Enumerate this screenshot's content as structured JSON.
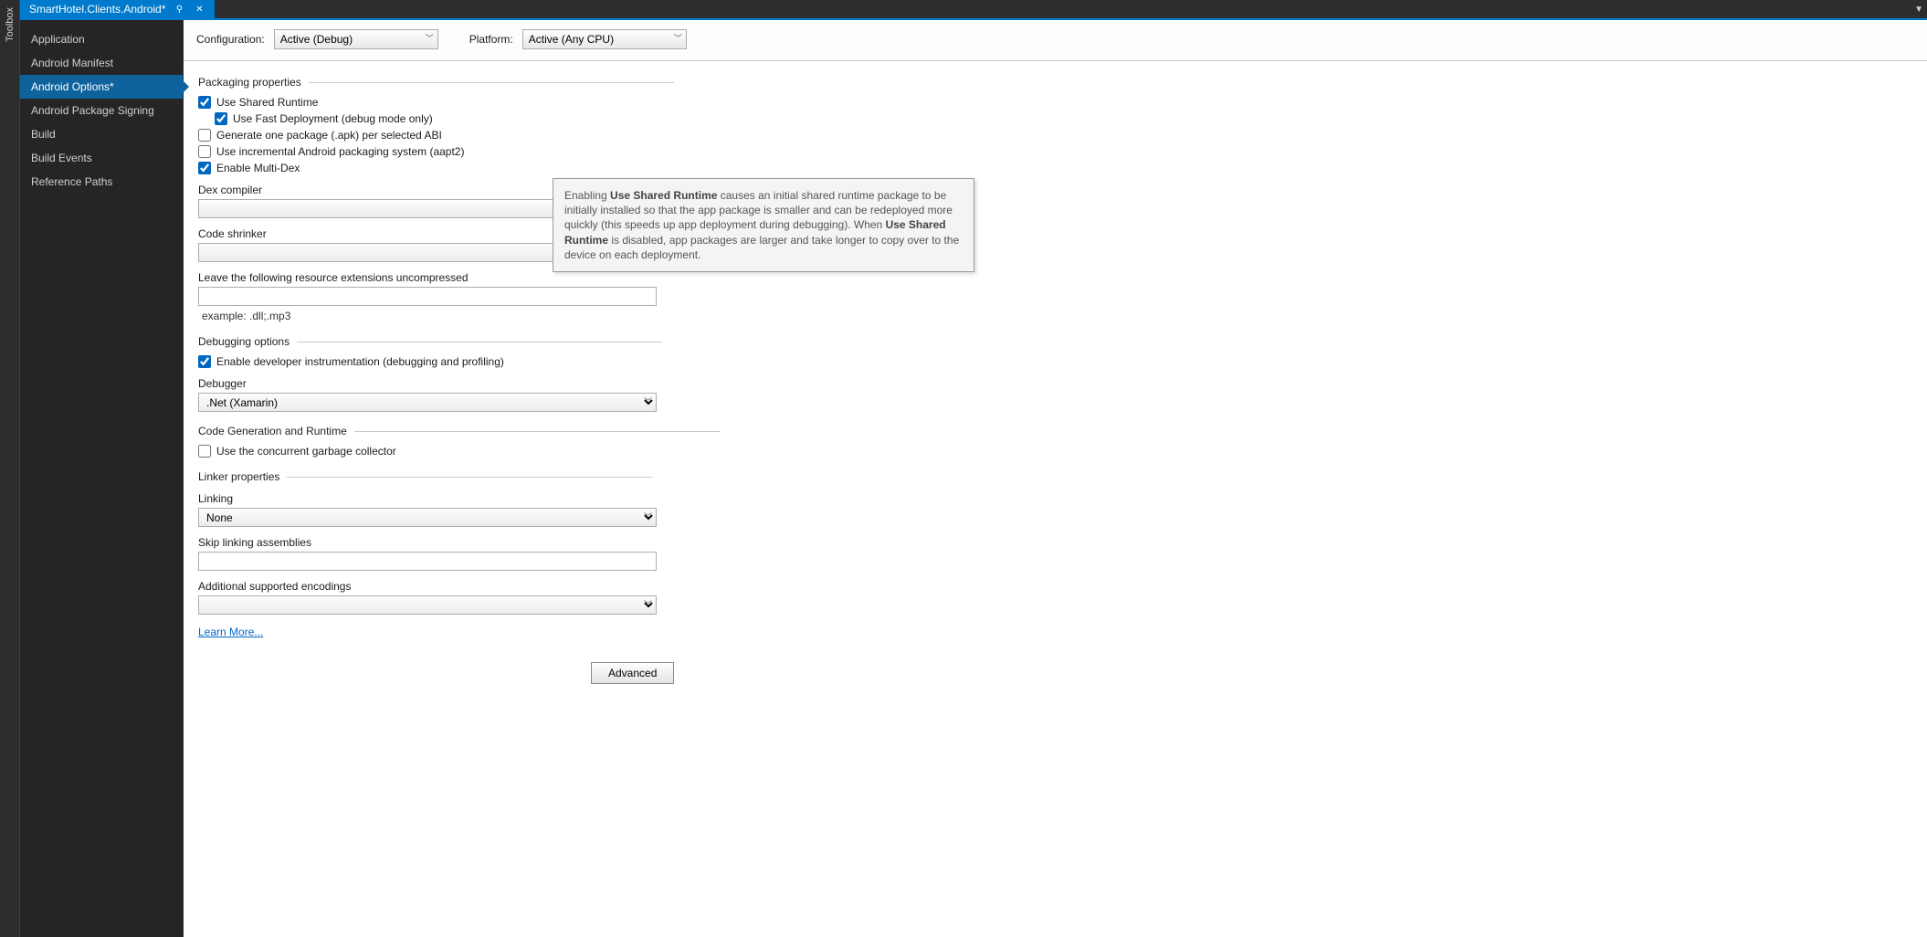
{
  "toolbox_label": "Toolbox",
  "tab": {
    "title": "SmartHotel.Clients.Android*",
    "pin_glyph": "⚲",
    "close_glyph": "✕"
  },
  "menu_caret": "▼",
  "nav": {
    "items": [
      "Application",
      "Android Manifest",
      "Android Options*",
      "Android Package Signing",
      "Build",
      "Build Events",
      "Reference Paths"
    ],
    "selected_index": 2
  },
  "config": {
    "configuration_label": "Configuration:",
    "configuration_value": "Active (Debug)",
    "platform_label": "Platform:",
    "platform_value": "Active (Any CPU)"
  },
  "sections": {
    "packaging": "Packaging properties",
    "debugging": "Debugging options",
    "codegen": "Code Generation and Runtime",
    "linker": "Linker properties"
  },
  "packaging": {
    "use_shared_runtime": "Use Shared Runtime",
    "use_fast_deployment": "Use Fast Deployment (debug mode only)",
    "generate_one_package": "Generate one package (.apk) per selected ABI",
    "use_incremental": "Use incremental Android packaging system (aapt2)",
    "enable_multidex": "Enable Multi-Dex",
    "dex_compiler_label": "Dex compiler",
    "code_shrinker_label": "Code shrinker",
    "resource_ext_label": "Leave the following resource extensions uncompressed",
    "resource_ext_hint": "example: .dll;.mp3"
  },
  "debugging": {
    "enable_instrumentation": "Enable developer instrumentation (debugging and profiling)",
    "debugger_label": "Debugger",
    "debugger_value": ".Net (Xamarin)"
  },
  "codegen": {
    "concurrent_gc": "Use the concurrent garbage collector"
  },
  "linker": {
    "linking_label": "Linking",
    "linking_value": "None",
    "skip_label": "Skip linking assemblies",
    "encodings_label": "Additional supported encodings",
    "learn_more": "Learn More..."
  },
  "advanced_button": "Advanced",
  "tooltip": {
    "t1": "Enabling ",
    "b1": "Use Shared Runtime",
    "t2": " causes an initial shared runtime package to be initially installed so that the app package is smaller and can be redeployed more quickly (this speeds up app deployment during debugging). When ",
    "b2": "Use Shared Runtime",
    "t3": " is disabled, app packages are larger and take longer to copy over to the device on each deployment."
  }
}
